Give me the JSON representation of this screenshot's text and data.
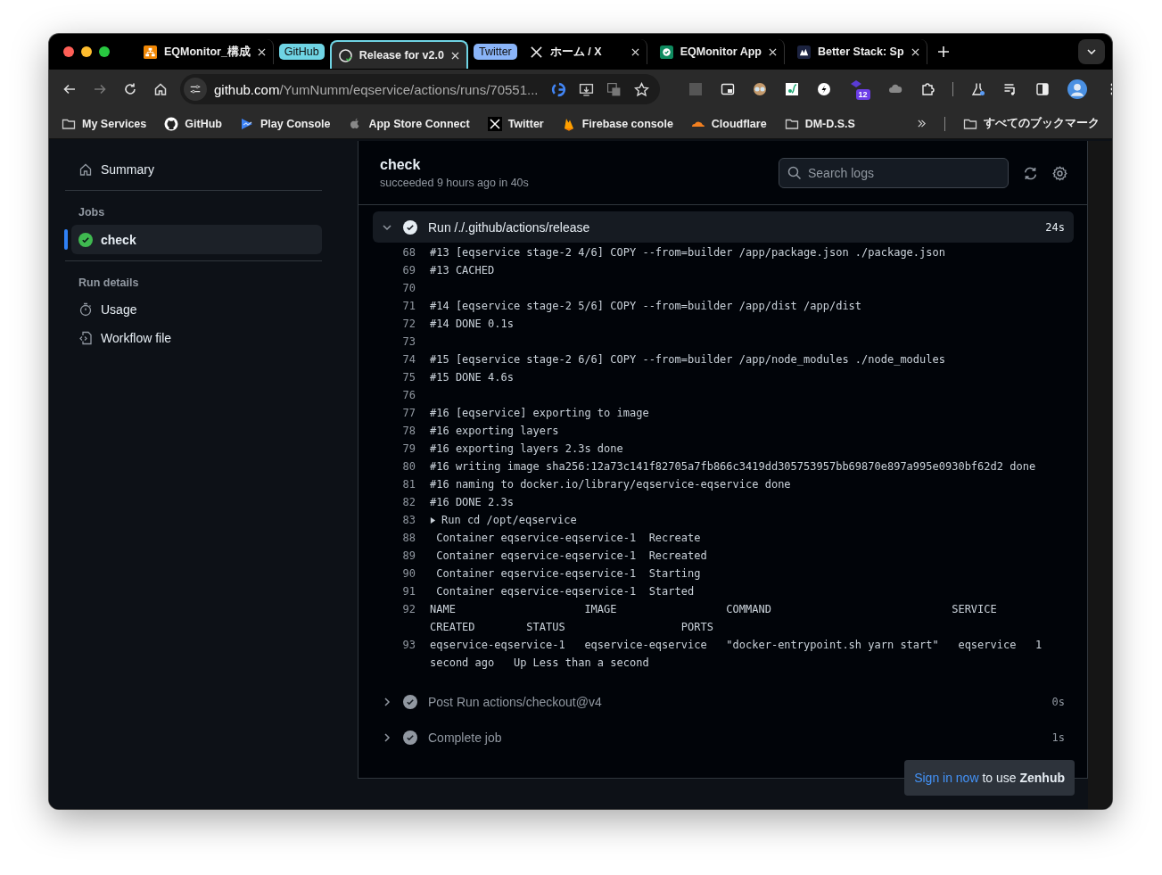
{
  "tabs": [
    {
      "kind": "tab",
      "title": "EQMonitor_構成",
      "selected": false
    },
    {
      "kind": "group",
      "label": "GitHub",
      "color": "#6fd4e4"
    },
    {
      "kind": "tab",
      "title": "Release for v2.0",
      "selected": true
    },
    {
      "kind": "group",
      "label": "Twitter",
      "color": "#8ab4f8"
    },
    {
      "kind": "tab",
      "title": "ホーム / X",
      "selected": false
    },
    {
      "kind": "tab",
      "title": "EQMonitor App",
      "selected": false
    },
    {
      "kind": "tab",
      "title": "Better Stack: Sp",
      "selected": false
    }
  ],
  "address_bar": {
    "host": "github.com",
    "path": "/YumNumm/eqservice/actions/runs/70551..."
  },
  "extension_badge": "12",
  "bookmarks": [
    {
      "label": "My Services"
    },
    {
      "label": "GitHub"
    },
    {
      "label": "Play Console"
    },
    {
      "label": "App Store Connect"
    },
    {
      "label": "Twitter"
    },
    {
      "label": "Firebase console"
    },
    {
      "label": "Cloudflare"
    },
    {
      "label": "DM-D.S.S"
    }
  ],
  "all_bookmarks": "すべてのブックマーク",
  "sidebar": {
    "summary": "Summary",
    "jobs_heading": "Jobs",
    "jobs": [
      {
        "name": "check",
        "selected": true
      }
    ],
    "run_details_heading": "Run details",
    "run_details": [
      "Usage",
      "Workflow file"
    ]
  },
  "job": {
    "title": "check",
    "status": "succeeded 9 hours ago in 40s",
    "search": {
      "placeholder": "Search logs"
    }
  },
  "steps": [
    {
      "name": "Run /./.github/actions/release",
      "duration": "24s",
      "expanded": true,
      "lines": [
        {
          "kind": "plain",
          "number": "68",
          "text": "#13 [eqservice stage-2 4/6] COPY --from=builder /app/package.json ./package.json"
        },
        {
          "kind": "plain",
          "number": "69",
          "text": "#13 CACHED"
        },
        {
          "kind": "plain",
          "number": "70"
        },
        {
          "kind": "plain",
          "number": "71",
          "text": "#14 [eqservice stage-2 5/6] COPY --from=builder /app/dist /app/dist"
        },
        {
          "kind": "plain",
          "number": "72",
          "text": "#14 DONE 0.1s"
        },
        {
          "kind": "plain",
          "number": "73"
        },
        {
          "kind": "plain",
          "number": "74",
          "text": "#15 [eqservice stage-2 6/6] COPY --from=builder /app/node_modules ./node_modules"
        },
        {
          "kind": "plain",
          "number": "75",
          "text": "#15 DONE 4.6s"
        },
        {
          "kind": "plain",
          "number": "76"
        },
        {
          "kind": "plain",
          "number": "77",
          "text": "#16 [eqservice] exporting to image"
        },
        {
          "kind": "plain",
          "number": "78",
          "text": "#16 exporting layers"
        },
        {
          "kind": "plain",
          "number": "79",
          "text": "#16 exporting layers 2.3s done"
        },
        {
          "kind": "plain",
          "number": "80",
          "text": "#16 writing image sha256:12a73c141f82705a7fb866c3419dd305753957bb69870e897a995e0930bf62d2 done"
        },
        {
          "kind": "plain",
          "number": "81",
          "text": "#16 naming to docker.io/library/eqservice-eqservice done"
        },
        {
          "kind": "plain",
          "number": "82",
          "text": "#16 DONE 2.3s"
        },
        {
          "kind": "group",
          "number": "83",
          "text": "Run cd /opt/eqservice"
        },
        {
          "kind": "plain",
          "number": "88",
          "text": " Container eqservice-eqservice-1  Recreate"
        },
        {
          "kind": "plain",
          "number": "89",
          "text": " Container eqservice-eqservice-1  Recreated"
        },
        {
          "kind": "plain",
          "number": "90",
          "text": " Container eqservice-eqservice-1  Starting"
        },
        {
          "kind": "plain",
          "number": "91",
          "text": " Container eqservice-eqservice-1  Started"
        },
        {
          "kind": "plain",
          "number": "92",
          "text": "NAME                    IMAGE                 COMMAND                            SERVICE             CREATED        STATUS                  PORTS"
        },
        {
          "kind": "plain",
          "number": "93",
          "text": "eqservice-eqservice-1   eqservice-eqservice   \"docker-entrypoint.sh yarn start\"   eqservice   1 second ago   Up Less than a second"
        }
      ]
    },
    {
      "name": "Post Run actions/checkout@v4",
      "duration": "0s",
      "expanded": false
    },
    {
      "name": "Complete job",
      "duration": "1s",
      "expanded": false
    }
  ],
  "toast": {
    "link": "Sign in now",
    "text": "to use **Zenhub**"
  }
}
